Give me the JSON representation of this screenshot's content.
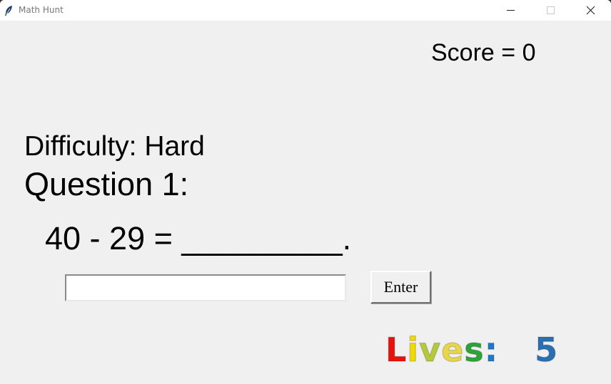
{
  "window": {
    "title": "Math Hunt",
    "icon": "feather-icon"
  },
  "controls": {
    "minimize_icon": "minimize-icon",
    "maximize_icon": "maximize-icon",
    "close_icon": "close-icon"
  },
  "game": {
    "score_text": "Score = 0",
    "difficulty_text": "Difficulty: Hard",
    "question_text": "Question 1:",
    "equation_text": "40 - 29 = _________.",
    "answer_value": "",
    "enter_label": "Enter",
    "lives": {
      "label_letters": [
        "L",
        "i",
        "v",
        "e",
        "s",
        ":"
      ],
      "letter_colors": [
        "#e8120c",
        "#f0d90a",
        "#b5c93a",
        "#e8d64a",
        "#2da43a",
        "#1d7ac8"
      ],
      "count": "5",
      "count_color": "#2a6fb4"
    }
  }
}
